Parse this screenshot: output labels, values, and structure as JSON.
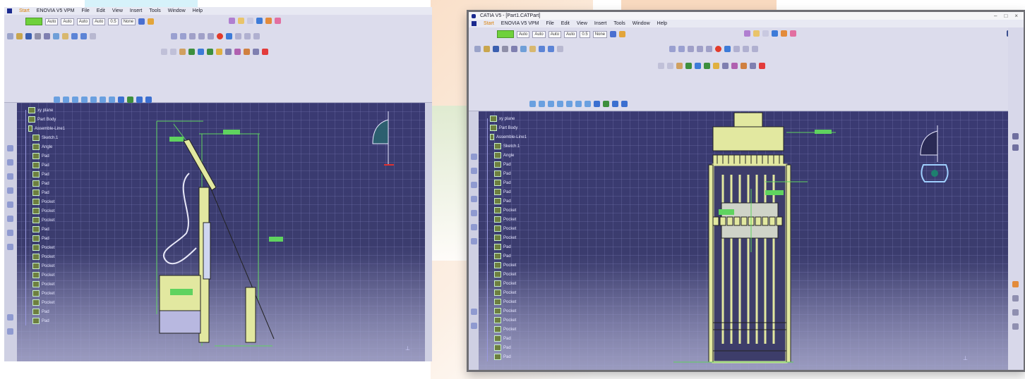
{
  "page": {
    "background": "#ffffff",
    "watermark_colors": {
      "orange": "#f6c9a3",
      "green": "#d9ecd0",
      "cyan": "#d6f2fa"
    }
  },
  "left_screenshot": {
    "menu": {
      "start": "Start",
      "workbench": "ENOVIA V5 VPM",
      "items": [
        "File",
        "Edit",
        "View",
        "Insert",
        "Tools",
        "Window",
        "Help"
      ]
    },
    "toolbar": {
      "color_swatch": "#6fd13b",
      "combos": [
        "Auto",
        "Auto",
        "Auto",
        "Auto",
        "0.5",
        "None"
      ]
    },
    "tree": [
      "xy plane",
      "Part Body",
      "Assemble-Line1",
      "Sketch.1",
      "Angle",
      "Pad",
      "Pad",
      "Pad",
      "Pad",
      "Pad",
      "Pocket",
      "Pocket",
      "Pocket",
      "Pad",
      "Pad",
      "Pocket",
      "Pocket",
      "Pocket",
      "Pocket",
      "Pocket",
      "Pocket",
      "Pocket",
      "Pad",
      "Pad"
    ],
    "colors": {
      "viewport": "#33335e",
      "geometry": "#e2e8a0",
      "constraint": "#5fd35f"
    }
  },
  "right_screenshot": {
    "window_title": "CATIA V5 - [Part1.CATPart]",
    "window_controls": [
      "–",
      "□",
      "×"
    ],
    "menu": {
      "start": "Start",
      "workbench": "ENOVIA V5 VPM",
      "items": [
        "File",
        "Edit",
        "View",
        "Insert",
        "Tools",
        "Window",
        "Help"
      ]
    },
    "toolbar": {
      "color_swatch": "#6fd13b",
      "combos": [
        "Auto",
        "Auto",
        "Auto",
        "Auto",
        "0.5",
        "None"
      ]
    },
    "tree": [
      "xy plane",
      "Part Body",
      "Assemble-Line1",
      "Sketch.1",
      "Angle",
      "Pad",
      "Pad",
      "Pad",
      "Pad",
      "Pad",
      "Pocket",
      "Pocket",
      "Pocket",
      "Pocket",
      "Pad",
      "Pad",
      "Pocket",
      "Pocket",
      "Pocket",
      "Pocket",
      "Pocket",
      "Pocket",
      "Pocket",
      "Pocket",
      "Pad",
      "Pad",
      "Pad"
    ],
    "colors": {
      "viewport": "#33335e",
      "geometry": "#e2e8a0",
      "constraint": "#5fd35f",
      "frame": "#6f6f74"
    }
  }
}
